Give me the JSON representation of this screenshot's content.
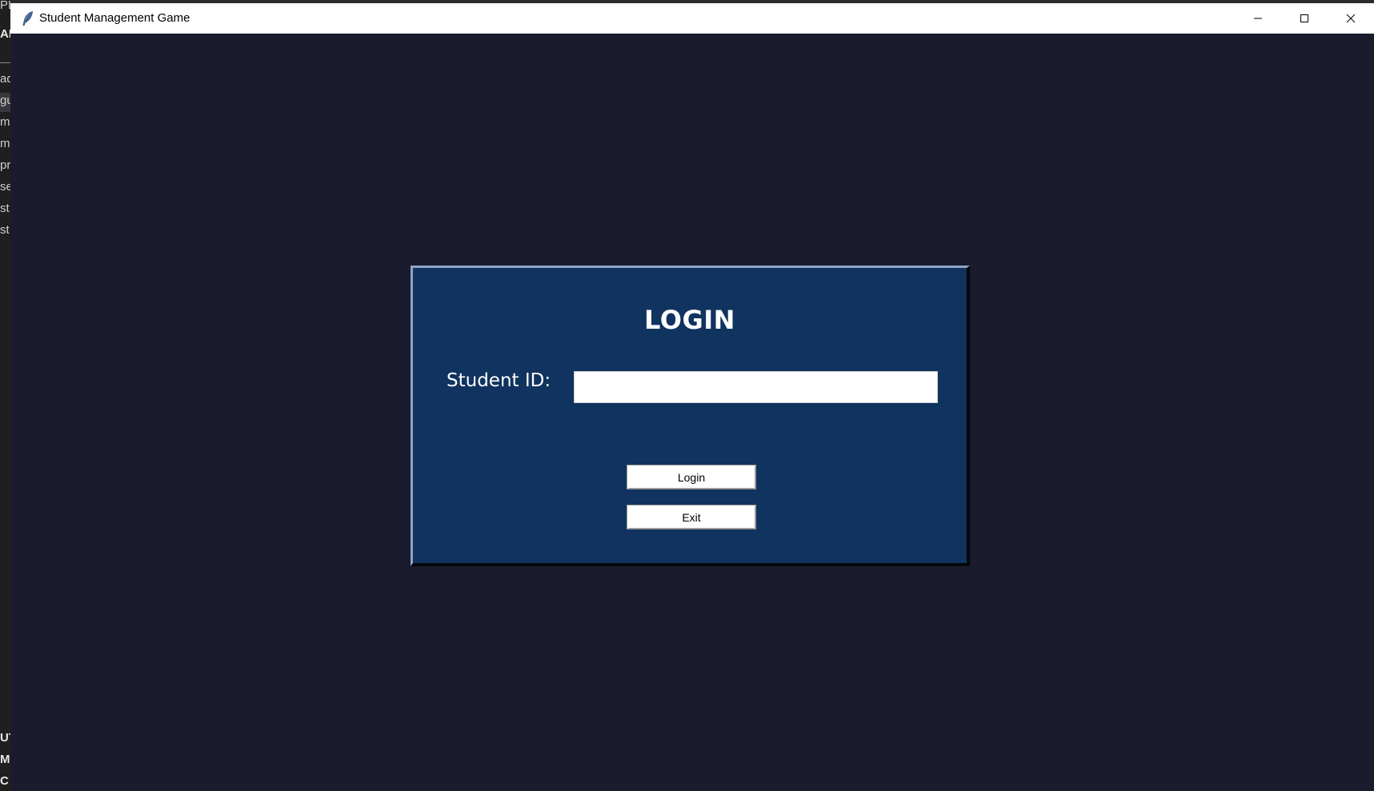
{
  "background_app": {
    "fragments": [
      {
        "text": "PL",
        "bold": false
      },
      {
        "text": "AR",
        "bold": true
      },
      {
        "text": "ad",
        "bold": false
      },
      {
        "text": "gu",
        "bold": false
      },
      {
        "text": "m",
        "bold": false
      },
      {
        "text": "m",
        "bold": false
      },
      {
        "text": "pr",
        "bold": false
      },
      {
        "text": "se",
        "bold": false
      },
      {
        "text": "st",
        "bold": false
      },
      {
        "text": "st",
        "bold": false
      },
      {
        "text": "UT",
        "bold": true
      },
      {
        "text": "ME",
        "bold": true
      },
      {
        "text": "C",
        "bold": true
      }
    ]
  },
  "window": {
    "title": "Student Management Game",
    "icon": "feather-icon",
    "controls": [
      "minimize-icon",
      "maximize-icon",
      "close-icon"
    ]
  },
  "login": {
    "heading": "LOGIN",
    "student_id_label": "Student ID:",
    "student_id_value": "",
    "login_button": "Login",
    "exit_button": "Exit"
  },
  "colors": {
    "window_background": "#1b1b2e",
    "panel_background": "#10335f",
    "panel_text": "#ffffff",
    "titlebar": "#ffffff"
  }
}
